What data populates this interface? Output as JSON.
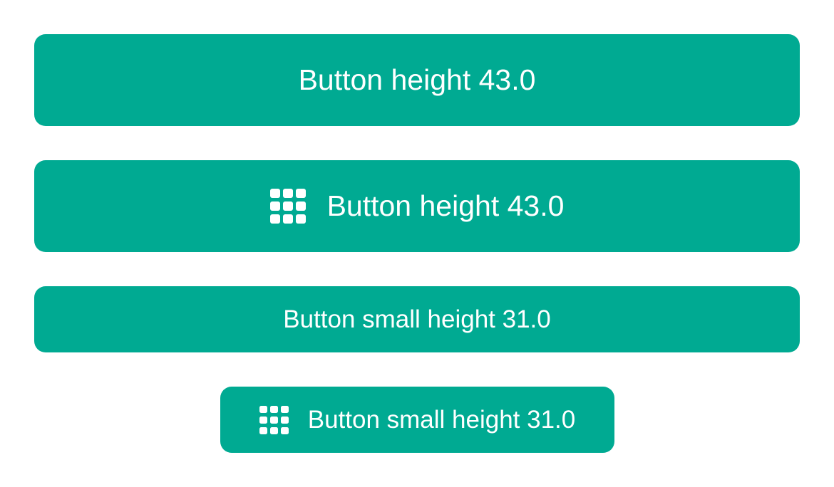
{
  "buttons": [
    {
      "label": "Button height 43.0",
      "icon": null
    },
    {
      "label": "Button height 43.0",
      "icon": "keypad-grid-icon"
    },
    {
      "label": "Button small height 31.0",
      "icon": null
    },
    {
      "label": "Button small height 31.0",
      "icon": "keypad-grid-icon"
    }
  ],
  "colors": {
    "button_background": "#00aa92",
    "button_text": "#ffffff",
    "page_background": "#ffffff"
  }
}
